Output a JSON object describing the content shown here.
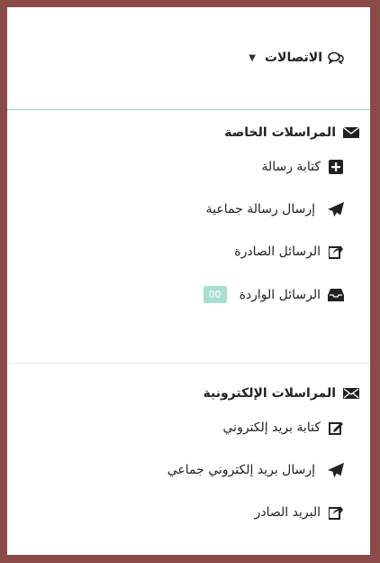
{
  "header": {
    "title": "الاتصالات",
    "icons": [
      "chat-bubbles-icon",
      "caret-down-icon"
    ]
  },
  "sections": [
    {
      "title": "المراسلات الخاصة",
      "icon": "envelope-icon",
      "items": [
        {
          "label": "كتابة رسالة",
          "icon": "plus-square-icon"
        },
        {
          "label": "إرسال رسالة جماعية",
          "icon": "paper-plane-icon"
        },
        {
          "label": "الرسائل الصادرة",
          "icon": "share-square-icon"
        },
        {
          "label": "الرسائل الواردة",
          "icon": "inbox-icon",
          "badge": "00"
        }
      ]
    },
    {
      "title": "المراسلات الإلكترونية",
      "icon": "envelope-open-icon",
      "items": [
        {
          "label": "كتابة بريد إلكتروني",
          "icon": "edit-icon"
        },
        {
          "label": "إرسال بريد إلكتروني جماعي",
          "icon": "paper-plane-icon"
        },
        {
          "label": "البريد الصادر",
          "icon": "share-square-icon"
        }
      ]
    }
  ],
  "colors": {
    "frame": "#8b4a48",
    "accent_line": "#8fd6c4",
    "badge_bg": "#a8e0cf"
  }
}
